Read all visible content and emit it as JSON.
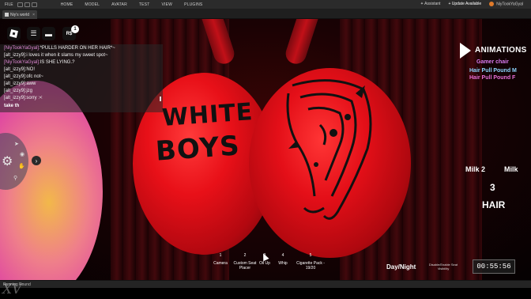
{
  "menubar": {
    "file": "FILE",
    "menus": [
      "HOME",
      "MODEL",
      "AVATAR",
      "TEST",
      "VIEW",
      "PLUGINS"
    ],
    "assistant": "Assistant",
    "update": "Update Available",
    "user": "NiyTookYaGyal"
  },
  "tab": {
    "title": "Niy's world",
    "close": "×"
  },
  "hud": {
    "notifications": "1",
    "robux_icon": "R$"
  },
  "chat": {
    "lines": [
      {
        "name": "[NiyTookYaGyal]:",
        "text": "*PULLS HARDER ON HER HAIR*~"
      },
      {
        "name": "",
        "text": "[alt_izzy9]:i loves it when it slams my sweet spot~"
      },
      {
        "name": "[NiyTookYaGyal]:",
        "text": "IS SHE LYING.?"
      },
      {
        "name": "",
        "text": "[alt_izzy9]:NO!"
      },
      {
        "name": "",
        "text": "[alt_izzy9]:ofc not~"
      },
      {
        "name": "",
        "text": "[alt_izzy9]:aww"
      },
      {
        "name": "",
        "text": "[alt_izzy9]:jzg"
      },
      {
        "name": "",
        "text": "[alt_izzy9]:sorry :<"
      }
    ],
    "input": "take th"
  },
  "scene": {
    "ball_text_line1": "WHITE",
    "ball_text_line2": "BOYS"
  },
  "animations": {
    "title": "ANIMATIONS",
    "items": [
      "Gamer chair",
      "Hair Pull Pound M",
      "Hair Pull Pound F"
    ],
    "colors": [
      "#d97bf0",
      "#8ed6ff",
      "#e86fd6"
    ]
  },
  "side_labels": {
    "milk2": "Milk 2",
    "milk": "Milk",
    "three": "3",
    "hair": "HAIR"
  },
  "hotbar": [
    {
      "num": "1",
      "label": "Camera"
    },
    {
      "num": "2",
      "label": "Custom Seat Placer"
    },
    {
      "num": "3",
      "label": "Oil Up"
    },
    {
      "num": "4",
      "label": "Whip"
    },
    {
      "num": "5",
      "label": "Cigarette Pack - 19/20"
    }
  ],
  "controls": {
    "day_night": "Day/Night",
    "body_toggle": "Disable/Enable Seat Visibility",
    "timer": "00:55:56"
  },
  "statusbar": {
    "text": "Running Round"
  },
  "watermark": "XV",
  "icons": [
    "roblox-logo-icon",
    "menu-icon",
    "chat-icon",
    "robux-icon",
    "gear-icon",
    "chevron-right-icon",
    "play-icon",
    "cursor-icon"
  ]
}
